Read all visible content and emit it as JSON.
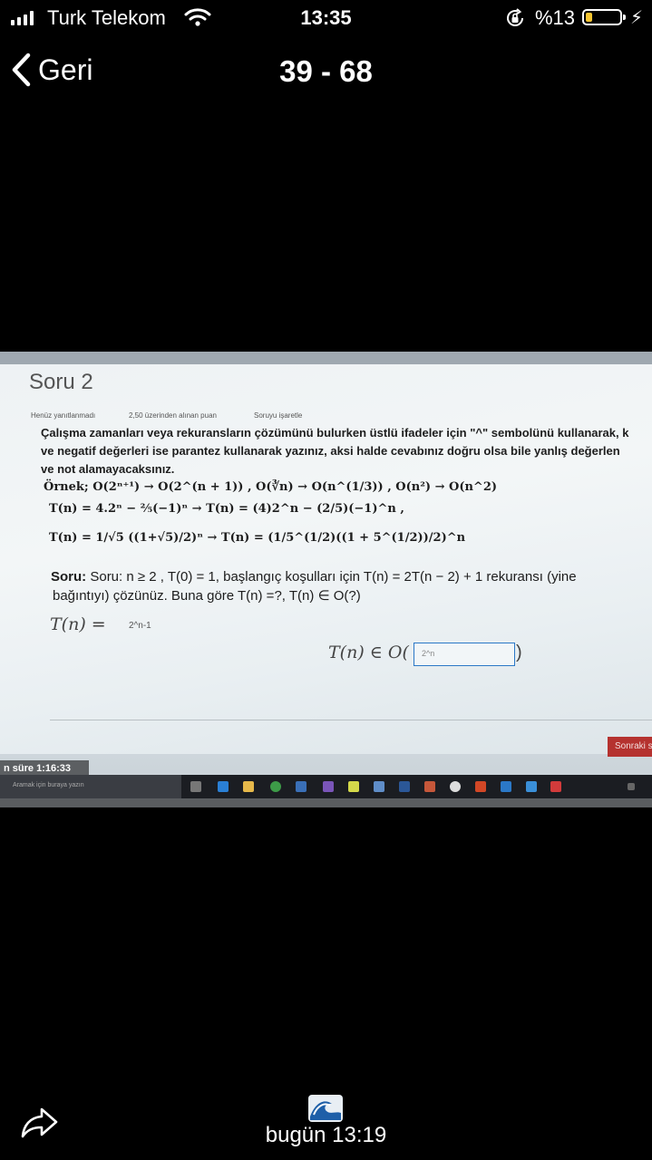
{
  "status_bar": {
    "carrier": "Turk Telekom",
    "time": "13:35",
    "battery_percent": "%13",
    "battery_level": 0.13,
    "battery_color": "#f7c531"
  },
  "nav": {
    "back_label": "Geri",
    "title": "39 - 68"
  },
  "photo": {
    "question_title": "Soru 2",
    "meta_status": "Henüz yanıtlanmadı",
    "meta_points": "2,50 üzerinden alınan puan",
    "meta_flag": "Soruyu işaretle",
    "instruction_line1": "Çalışma zamanları veya rekuransların çözümünü bulurken üstlü ifadeler için \"^\" sembolünü kullanarak, k",
    "instruction_line2": "ve negatif değerleri ise parantez kullanarak yazınız, aksi halde cevabınız doğru olsa bile yanlış değerlen",
    "instruction_line3": "ve not alamayacaksınız.",
    "example_line1": "Örnek; O(2ⁿ⁺¹) → O(2^(n + 1)) ,  O(∛n) → O(n^(1/3)) , O(n²) → O(n^2)",
    "example_line2": "T(n) = 4.2ⁿ − ⅖(−1)ⁿ → T(n) = (4)2^n − (2/5)(−1)^n ,",
    "example_line3": "T(n) = 1/√5 ((1+√5)/2)ⁿ → T(n) = (1/5^(1/2)((1 + 5^(1/2))/2)^n",
    "question_line1": "Soru: n ≥ 2 , T(0) = 1, başlangıç koşulları için T(n) = 2T(n − 2) + 1 rekuransı (yine",
    "question_line2": "bağıntıyı) çözünüz.  Buna göre T(n) =?,  T(n) ∈ O(?)",
    "answer1_label": "T(n) =",
    "answer1_value": "2^n-1",
    "answer2_label": "T(n) ∈ O(",
    "answer2_value": "2^n",
    "answer2_close": ")",
    "next_button": "Sonraki s",
    "timer": "n süre 1:16:33",
    "taskbar_search": "Aramak için buraya yazın",
    "accent_color": "#2b78c7",
    "next_color": "#b5322f"
  },
  "footer": {
    "date": "bugün 13:19"
  }
}
